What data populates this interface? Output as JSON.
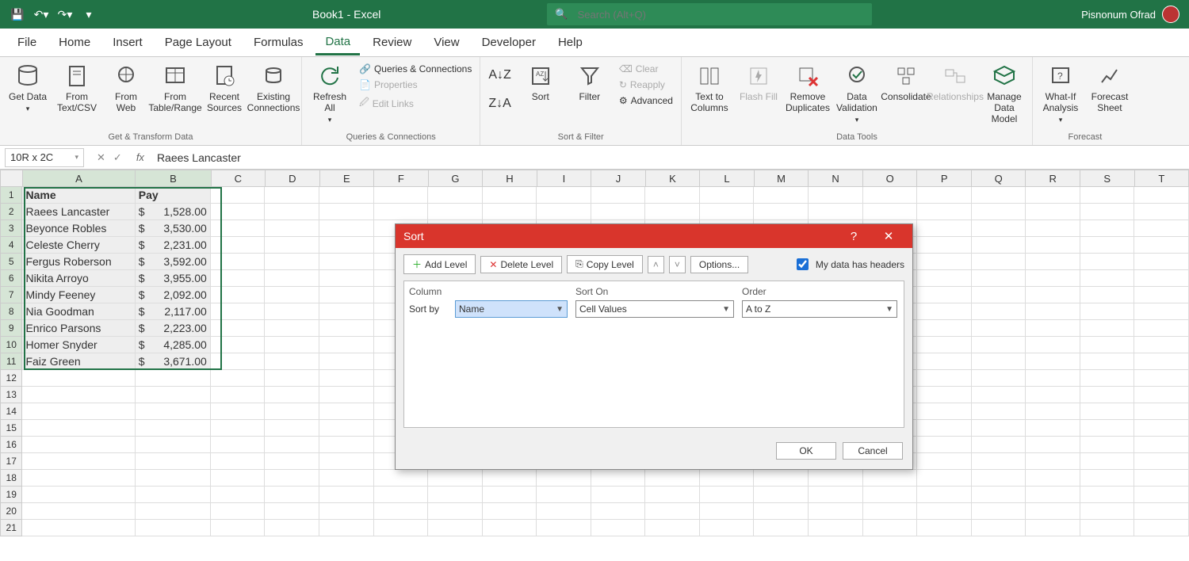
{
  "titlebar": {
    "document_title": "Book1 - Excel",
    "search_placeholder": "Search (Alt+Q)",
    "user_name": "Pisnonum Ofrad"
  },
  "tabs": [
    "File",
    "Home",
    "Insert",
    "Page Layout",
    "Formulas",
    "Data",
    "Review",
    "View",
    "Developer",
    "Help"
  ],
  "active_tab": "Data",
  "ribbon": {
    "groups": [
      {
        "label": "Get & Transform Data",
        "buttons": [
          "Get Data",
          "From Text/CSV",
          "From Web",
          "From Table/Range",
          "Recent Sources",
          "Existing Connections"
        ]
      },
      {
        "label": "Queries & Connections",
        "refresh": "Refresh All",
        "items": [
          "Queries & Connections",
          "Properties",
          "Edit Links"
        ]
      },
      {
        "label": "Sort & Filter",
        "sort": "Sort",
        "filter": "Filter",
        "items": [
          "Clear",
          "Reapply",
          "Advanced"
        ]
      },
      {
        "label": "Data Tools",
        "buttons": [
          "Text to Columns",
          "Flash Fill",
          "Remove Duplicates",
          "Data Validation",
          "Consolidate",
          "Relationships",
          "Manage Data Model"
        ]
      },
      {
        "label": "Forecast",
        "buttons": [
          "What-If Analysis",
          "Forecast Sheet"
        ]
      }
    ]
  },
  "formula_bar": {
    "name_box": "10R x 2C",
    "value": "Raees Lancaster"
  },
  "columns": [
    "A",
    "B",
    "C",
    "D",
    "E",
    "F",
    "G",
    "H",
    "I",
    "J",
    "K",
    "L",
    "M",
    "N",
    "O",
    "P",
    "Q",
    "R",
    "S",
    "T"
  ],
  "sheet": {
    "headers": [
      "Name",
      "Pay"
    ],
    "rows": [
      {
        "name": "Raees Lancaster",
        "cur": "$",
        "pay": "1,528.00"
      },
      {
        "name": "Beyonce Robles",
        "cur": "$",
        "pay": "3,530.00"
      },
      {
        "name": "Celeste Cherry",
        "cur": "$",
        "pay": "2,231.00"
      },
      {
        "name": "Fergus Roberson",
        "cur": "$",
        "pay": "3,592.00"
      },
      {
        "name": "Nikita Arroyo",
        "cur": "$",
        "pay": "3,955.00"
      },
      {
        "name": "Mindy Feeney",
        "cur": "$",
        "pay": "2,092.00"
      },
      {
        "name": "Nia Goodman",
        "cur": "$",
        "pay": "2,117.00"
      },
      {
        "name": "Enrico Parsons",
        "cur": "$",
        "pay": "2,223.00"
      },
      {
        "name": "Homer Snyder",
        "cur": "$",
        "pay": "4,285.00"
      },
      {
        "name": "Faiz Green",
        "cur": "$",
        "pay": "3,671.00"
      }
    ]
  },
  "dialog": {
    "title": "Sort",
    "add_level": "Add Level",
    "delete_level": "Delete Level",
    "copy_level": "Copy Level",
    "options": "Options...",
    "headers_checkbox": "My data has headers",
    "col_header": "Column",
    "sorton_header": "Sort On",
    "order_header": "Order",
    "sortby_label": "Sort by",
    "sortby_value": "Name",
    "sorton_value": "Cell Values",
    "order_value": "A to Z",
    "ok": "OK",
    "cancel": "Cancel"
  }
}
